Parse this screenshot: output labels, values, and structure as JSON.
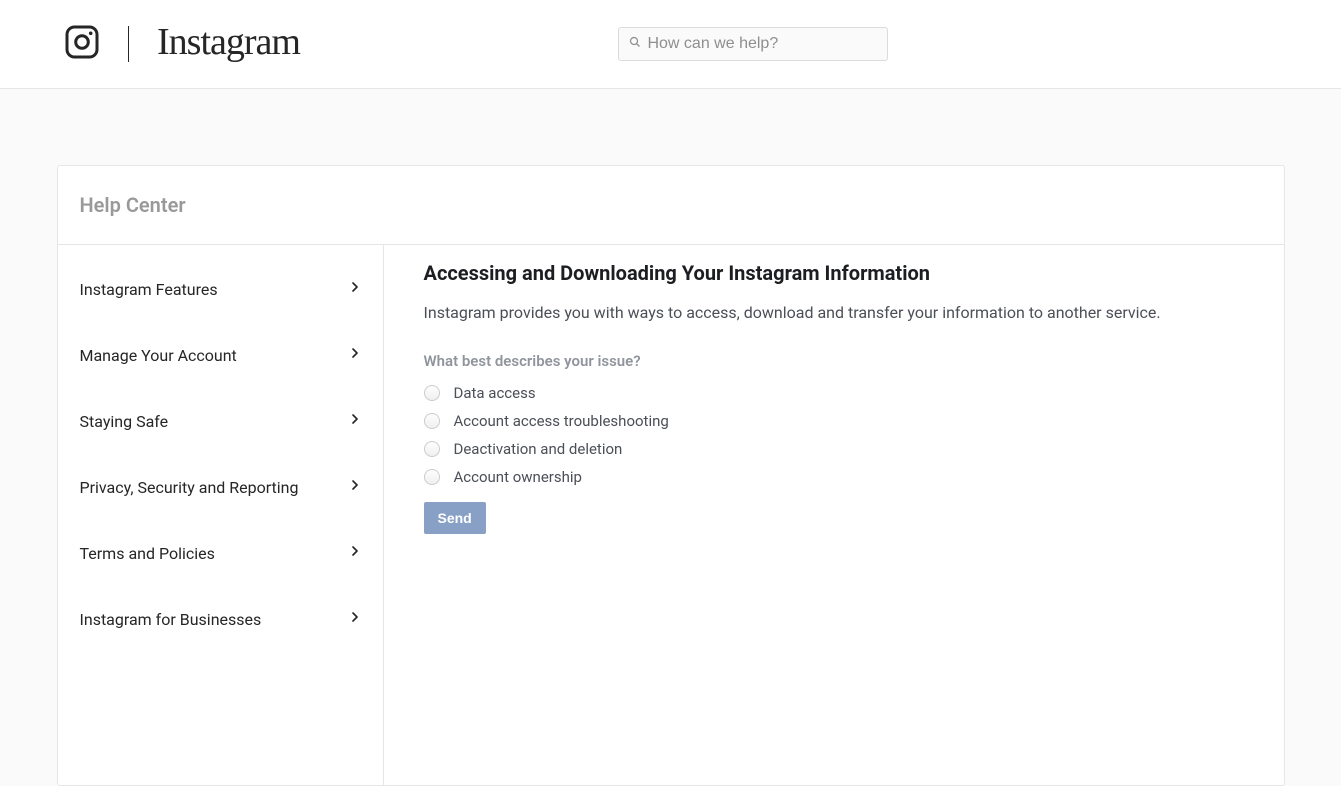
{
  "brand": "Instagram",
  "search": {
    "placeholder": "How can we help?"
  },
  "help_center_title": "Help Center",
  "sidebar": {
    "items": [
      {
        "label": "Instagram Features"
      },
      {
        "label": "Manage Your Account"
      },
      {
        "label": "Staying Safe"
      },
      {
        "label": "Privacy, Security and Reporting"
      },
      {
        "label": "Terms and Policies"
      },
      {
        "label": "Instagram for Businesses"
      }
    ]
  },
  "main": {
    "title": "Accessing and Downloading Your Instagram Information",
    "intro": "Instagram provides you with ways to access, download and transfer your information to another service.",
    "question": "What best describes your issue?",
    "options": [
      "Data access",
      "Account access troubleshooting",
      "Deactivation and deletion",
      "Account ownership"
    ],
    "send_label": "Send"
  }
}
